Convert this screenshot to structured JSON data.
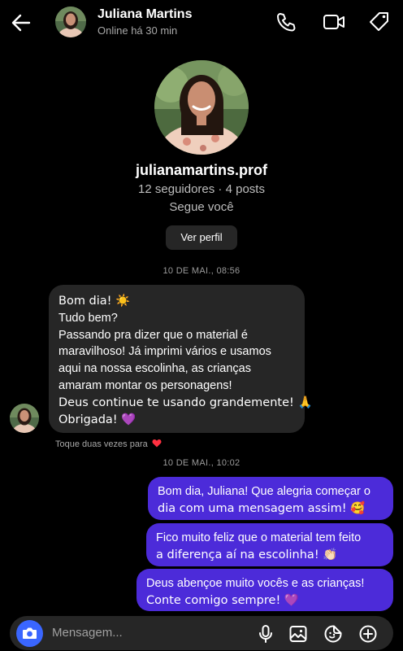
{
  "header": {
    "name": "Juliana Martins",
    "status": "Online há 30 min"
  },
  "profile": {
    "username": "julianamartins.prof",
    "stats": "12 seguidores · 4 posts",
    "follows_you": "Segue você",
    "view_profile_label": "Ver perfil"
  },
  "thread": {
    "timestamp_1": "10 DE MAI., 08:56",
    "received_lines": [
      "Bom dia! ☀️",
      "Tudo bem?",
      "Passando pra dizer que o material é",
      "maravilhoso! Já imprimi vários e usamos",
      "aqui na nossa escolinha, as crianças",
      "amaram montar os personagens!",
      "Deus continue te usando grandemente! 🙏",
      "Obrigada! 💜"
    ],
    "double_tap_hint": "Toque duas vezes para",
    "timestamp_2": "10 DE MAI., 10:02",
    "sent": [
      {
        "lines": [
          "Bom dia, Juliana! Que alegria começar o",
          "dia com uma mensagem assim! 🥰"
        ]
      },
      {
        "lines": [
          "Fico muito feliz que o material tem feito",
          "a diferença aí na escolinha! 👏🏻"
        ]
      },
      {
        "lines": [
          "Deus abençoe muito vocês e as crianças!",
          "Conte comigo sempre! 💜"
        ]
      }
    ]
  },
  "composer": {
    "placeholder": "Mensagem..."
  },
  "colors": {
    "background": "#000000",
    "received_bubble": "#262626",
    "sent_bubble": "#4c2bd9",
    "camera_button": "#3a66ff"
  },
  "icons": {
    "back": "arrow-left-icon",
    "call": "phone-icon",
    "video": "video-icon",
    "tag": "tag-icon",
    "camera": "camera-icon",
    "mic": "microphone-icon",
    "gallery": "image-icon",
    "sticker": "sticker-icon",
    "plus": "plus-circle-icon",
    "heart": "heart-icon"
  }
}
